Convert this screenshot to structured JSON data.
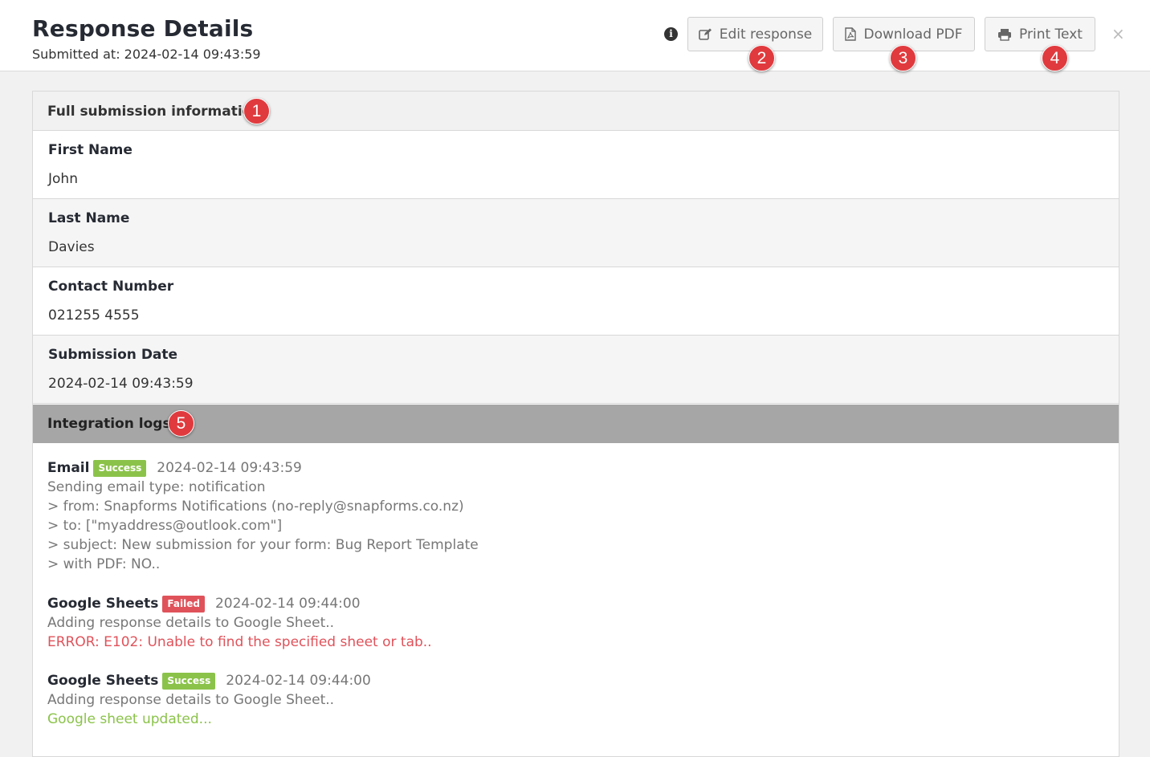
{
  "header": {
    "title": "Response Details",
    "submitted_at": "Submitted at: 2024-02-14 09:43:59",
    "info_icon": "info-circle-icon",
    "buttons": {
      "edit": "Edit response",
      "download_pdf": "Download PDF",
      "print_text": "Print Text"
    },
    "close": "×"
  },
  "markers": [
    "1",
    "2",
    "3",
    "4",
    "5"
  ],
  "submission": {
    "heading": "Full submission information",
    "fields": [
      {
        "label": "First Name",
        "value": "John"
      },
      {
        "label": "Last Name",
        "value": "Davies"
      },
      {
        "label": "Contact Number",
        "value": "021255 4555"
      },
      {
        "label": "Submission Date",
        "value": "2024-02-14 09:43:59"
      }
    ]
  },
  "integrations": {
    "heading": "Integration logs",
    "logs": [
      {
        "name": "Email",
        "status": "Success",
        "time": "2024-02-14 09:43:59",
        "lines": [
          "Sending email type: notification",
          "> from: Snapforms Notifications (no-reply@snapforms.co.nz)",
          "> to: [\"myaddress@outlook.com\"]",
          "> subject: New submission for your form: Bug Report Template",
          "> with PDF: NO.."
        ]
      },
      {
        "name": "Google Sheets",
        "status": "Failed",
        "time": "2024-02-14 09:44:00",
        "lines": [
          "Adding response details to Google Sheet.."
        ],
        "result": "ERROR: E102: Unable to find the specified sheet or tab.."
      },
      {
        "name": "Google Sheets",
        "status": "Success",
        "time": "2024-02-14 09:44:00",
        "lines": [
          "Adding response details to Google Sheet.."
        ],
        "result": "Google sheet updated..."
      }
    ]
  },
  "colors": {
    "success": "#8bc34a",
    "failed": "#e0525a",
    "marker": "#e03a3e"
  }
}
